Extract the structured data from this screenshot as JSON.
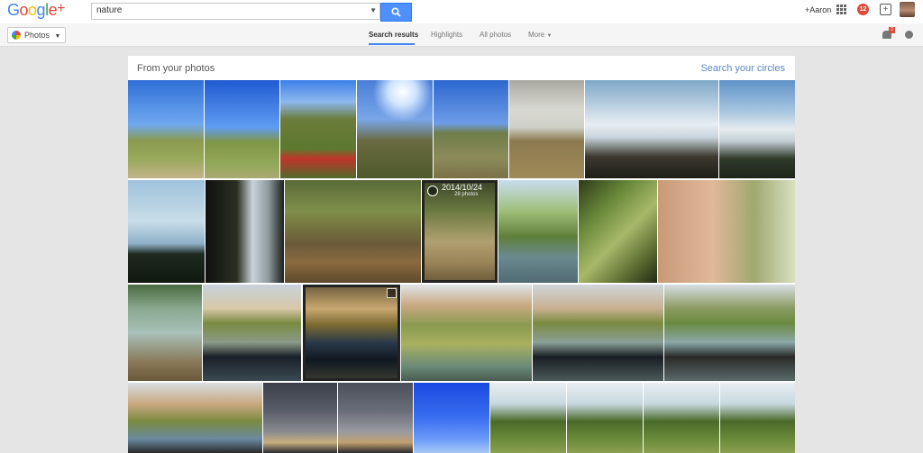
{
  "app": {
    "logo_text": "Google+",
    "account_name": "+Aaron",
    "notifications_count": "12",
    "bell_badge": "2"
  },
  "search": {
    "value": "nature"
  },
  "nav": {
    "photos_label": "Photos",
    "tabs": [
      "Search results",
      "Highlights",
      "All photos",
      "More"
    ],
    "active_tab": "Search results"
  },
  "panel": {
    "title": "From your photos",
    "circles_link": "Search your circles"
  },
  "featured": {
    "date": "2014/10/24",
    "count": "28 photos"
  },
  "icons": [
    "search-icon",
    "dropdown-arrow-icon",
    "apps-grid-icon",
    "notifications-icon",
    "share-icon",
    "avatar",
    "photos-pinwheel-icon",
    "chevron-down-icon",
    "bell-icon",
    "location-icon",
    "check-circle-icon",
    "expand-icon"
  ],
  "colors": {
    "accent_blue": "#4285f4",
    "search_button": "#4d90fe",
    "notification_red": "#dd4b39",
    "link_blue": "#5b88c2"
  }
}
